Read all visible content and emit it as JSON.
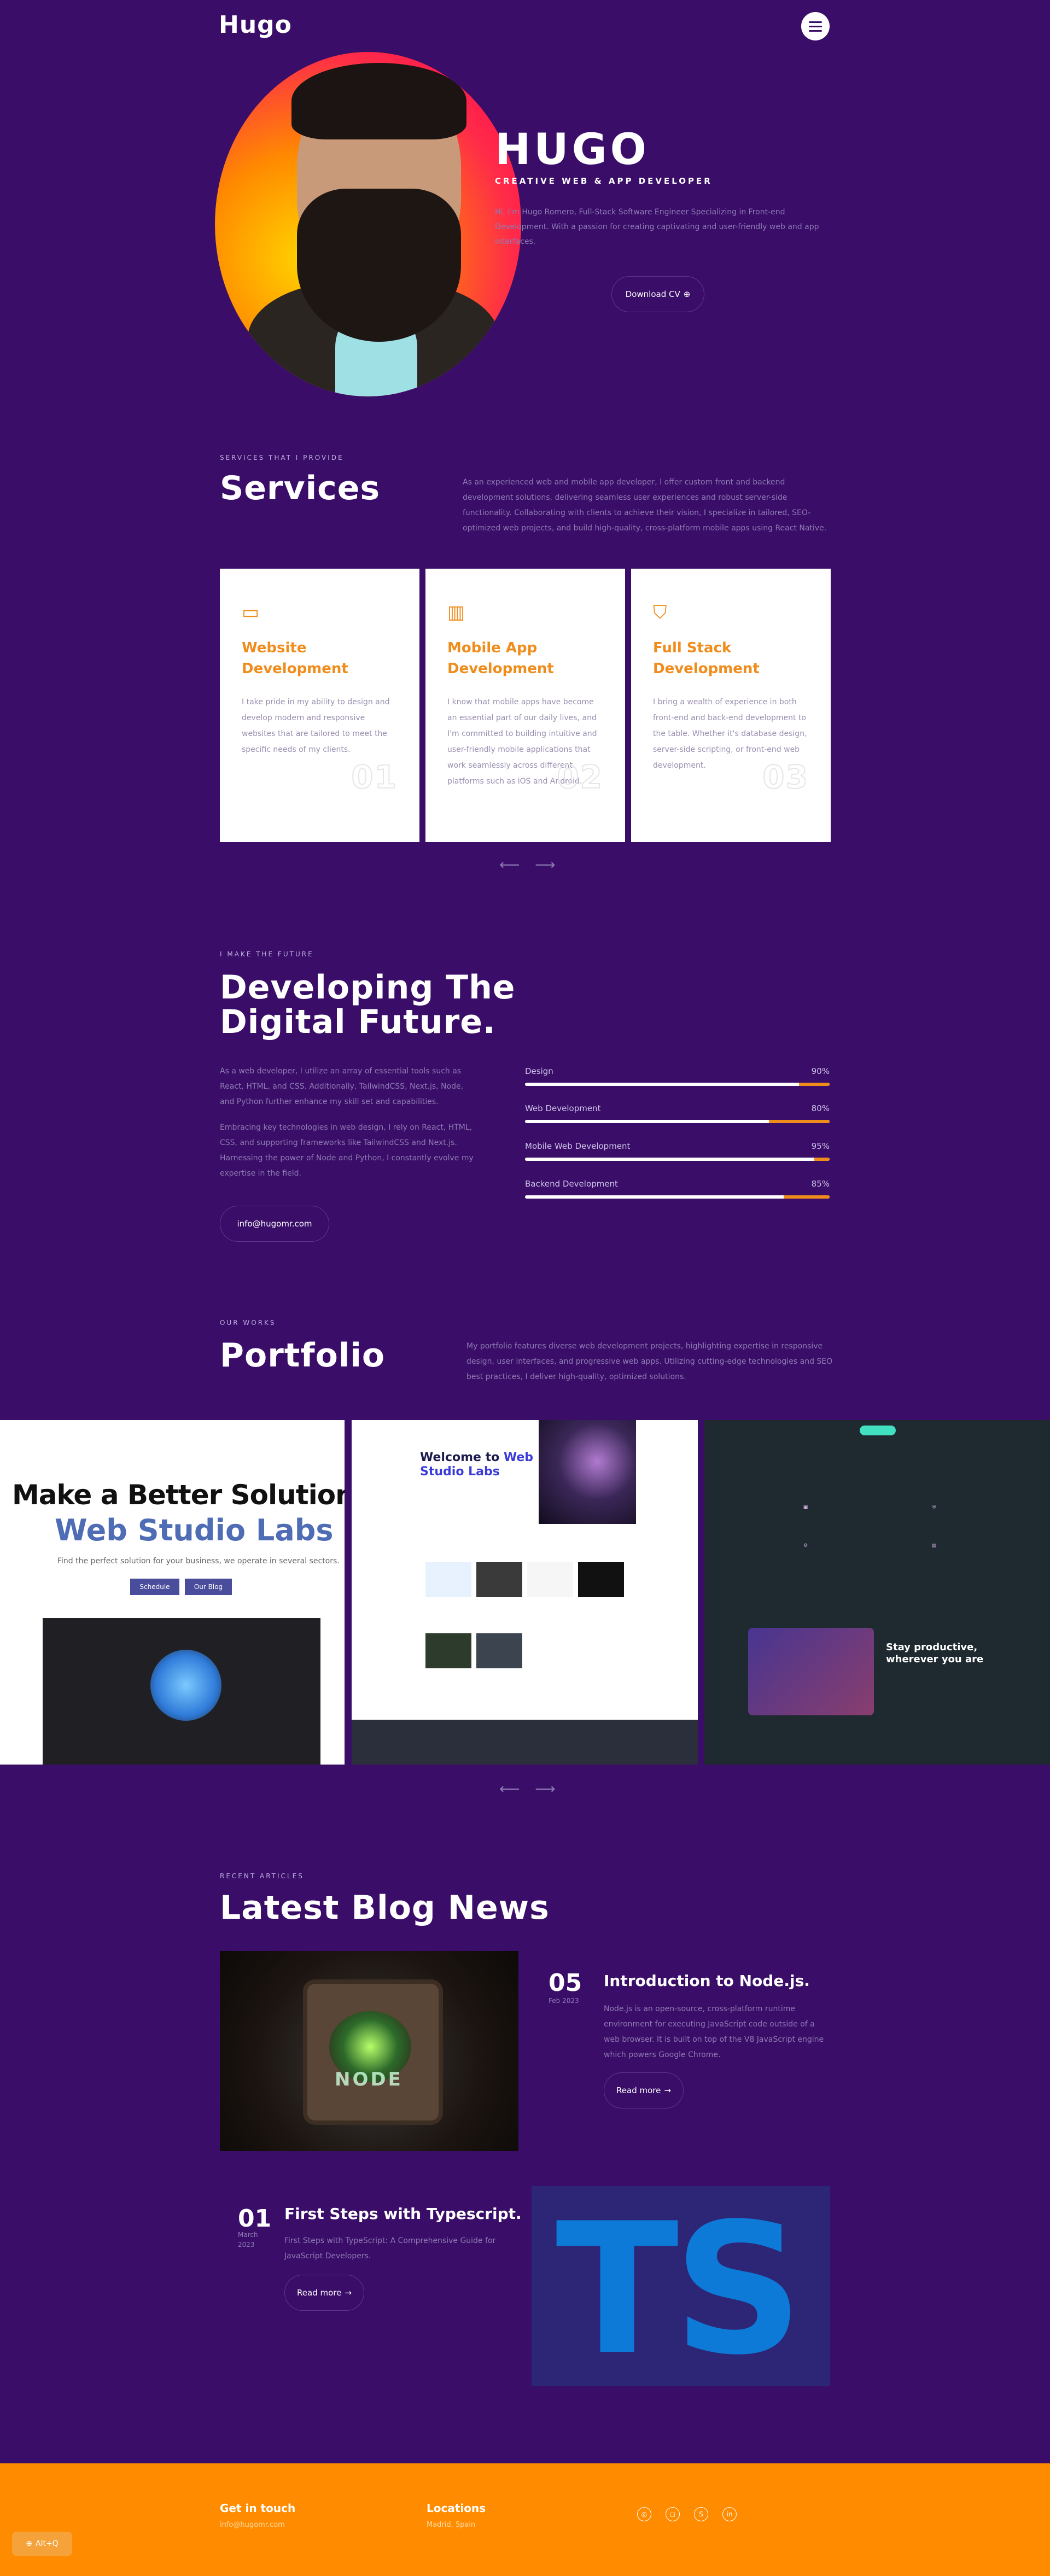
{
  "header": {
    "logo": "Hugo",
    "menu_icon": "hamburger-menu-icon"
  },
  "hero": {
    "name": "HUGO",
    "role": "CREATIVE WEB & APP DEVELOPER",
    "desc": "Hi, I'm Hugo Romero, Full-Stack Software Engineer Specializing in Front-end Development. With a passion for creating captivating and user-friendly web and app interfaces.",
    "cv_button": "Download CV",
    "cv_icon": "download-icon"
  },
  "services": {
    "kicker": "SERVICES THAT I PROVIDE",
    "title": "Services",
    "desc": "As an experienced web and mobile app developer, I offer custom front and backend development solutions, delivering seamless user experiences and robust server-side functionality. Collaborating with clients to achieve their vision, I specialize in tailored, SEO-optimized web projects, and build high-quality, cross-platform mobile apps using React Native.",
    "cards": [
      {
        "title": "Website Development",
        "text": "I take pride in my ability to design and develop modern and responsive websites that are tailored to meet the specific needs of my clients.",
        "num": "01",
        "icon": "monitor-icon"
      },
      {
        "title": "Mobile App Development",
        "text": "I know that mobile apps have become an essential part of our daily lives, and I'm committed to building intuitive and user-friendly mobile applications that work seamlessly across different platforms such as iOS and Android.",
        "num": "02",
        "icon": "building-icon"
      },
      {
        "title": "Full Stack Development",
        "text": "I bring a wealth of experience in both front-end and back-end development to the table. Whether it's database design, server-side scripting, or front-end web development.",
        "num": "03",
        "icon": "basket-icon"
      }
    ],
    "prev": "⟵",
    "next": "⟶"
  },
  "future": {
    "kicker": "I MAKE THE FUTURE",
    "title_l1": "Developing The",
    "title_l2": "Digital Future.",
    "p1": "As a web developer, I utilize an array of essential tools such as React, HTML, and CSS. Additionally, TailwindCSS, Next.js, Node, and Python further enhance my skill set and capabilities.",
    "p2": "Embracing key technologies in web design, I rely on React, HTML, CSS, and supporting frameworks like TailwindCSS and Next.js. Harnessing the power of Node and Python, I constantly evolve my expertise in the field.",
    "email": "info@hugomr.com",
    "skills": [
      {
        "name": "Design",
        "pct": "90%",
        "value": 90
      },
      {
        "name": "Web Development",
        "pct": "80%",
        "value": 80
      },
      {
        "name": "Mobile Web Development",
        "pct": "95%",
        "value": 95
      },
      {
        "name": "Backend Development",
        "pct": "85%",
        "value": 85
      }
    ]
  },
  "portfolio": {
    "kicker": "OUR WORKS",
    "title": "Portfolio",
    "desc": "My portfolio features diverse web development projects, highlighting expertise in responsive design, user interfaces, and progressive web apps. Utilizing cutting-edge technologies and SEO best practices, I deliver high-quality, optimized solutions.",
    "item1": {
      "h1": "Make a Better Solution",
      "h2": "Web Studio Labs",
      "sub": "Find the perfect solution for your business, we operate in several sectors.",
      "b1": "Schedule",
      "b2": "Our Blog"
    },
    "item2": {
      "h_a": "Welcome to ",
      "h_b": "Web",
      "h_c": "Studio Labs"
    },
    "item3": {
      "prod_l1": "Stay productive,",
      "prod_l2": "wherever you are"
    },
    "prev": "⟵",
    "next": "⟶"
  },
  "blog": {
    "kicker": "RECENT ARTICLES",
    "title": "Latest Blog News",
    "post1": {
      "day": "05",
      "month": "Feb 2023",
      "title": "Introduction to Node.js.",
      "desc": "Node.js is an open-source, cross-platform runtime environment for executing JavaScript code outside of a web browser. It is built on top of the V8 JavaScript engine which powers Google Chrome.",
      "btn": "Read more",
      "image_text": "NODE"
    },
    "post2": {
      "day": "01",
      "month": "March 2023",
      "title": "First Steps with Typescript.",
      "desc": "First Steps with TypeScript: A Comprehensive Guide for JavaScript Developers.",
      "btn": "Read more",
      "image_text": "TS"
    }
  },
  "footer": {
    "get_title": "Get in touch",
    "get_sub": "info@hugomr.com",
    "loc_title": "Locations",
    "loc_sub": "Madrid, Spain",
    "socials": [
      "github-icon",
      "instagram-icon",
      "skype-icon",
      "linkedin-icon"
    ]
  },
  "hotkey": {
    "label": "Alt+Q"
  }
}
